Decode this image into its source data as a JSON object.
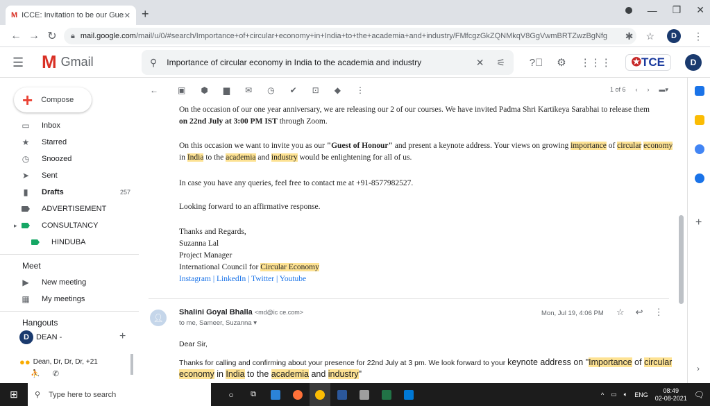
{
  "browser": {
    "tab_title": "ICCE: Invitation to be our Guest",
    "tab_close": "✕",
    "new_tab": "+",
    "url_host": "mail.google.com",
    "url_path": "/mail/u/0/#search/Importance+of+circular+economy+in+India+to+the+academia+and+industry/FMfcgzGkZQNMkqV8GgVwmBRTZwzBgNfg",
    "profile_initial": "D"
  },
  "gmail": {
    "app_name": "Gmail",
    "search_query": "Importance of circular economy in India to the academia and industry",
    "org_badge": "TCE",
    "profile_initial": "D"
  },
  "sidebar": {
    "compose": "Compose",
    "items": [
      {
        "label": "Inbox",
        "icon": "inbox-icon"
      },
      {
        "label": "Starred",
        "icon": "star-icon"
      },
      {
        "label": "Snoozed",
        "icon": "clock-icon"
      },
      {
        "label": "Sent",
        "icon": "send-icon"
      },
      {
        "label": "Drafts",
        "icon": "draft-icon",
        "count": "257"
      },
      {
        "label": "ADVERTISEMENT",
        "icon": "label-icon"
      },
      {
        "label": "CONSULTANCY",
        "icon": "label-icon"
      },
      {
        "label": "HINDUBA",
        "icon": "label-icon"
      }
    ],
    "meet_title": "Meet",
    "meet_items": [
      {
        "label": "New meeting",
        "icon": "video-icon"
      },
      {
        "label": "My meetings",
        "icon": "calendar-icon"
      }
    ],
    "hangouts_title": "Hangouts",
    "hangouts_user": "DEAN",
    "hangouts_user_suffix": "-",
    "hangouts_group": "Dean, Dr, Dr, Dr, +21"
  },
  "toolbar": {
    "pager": "1 of 6"
  },
  "email1": {
    "p1a": "On the occasion of our one year anniversary, we are releasing our 2 of our courses.  We have invited Padma Shri Kartikeya Sarabhai to release them",
    "p1b_bold": "on 22nd July at 3:00 PM IST",
    "p1b_rest": " through Zoom.",
    "p2_start": "On this occasion we want to invite you as our ",
    "p2_bold": "\"Guest of Honour\"",
    "p2_mid": " and present a keynote address. Your views on growing ",
    "p2_h1": "importance",
    "p2_of": " of ",
    "p2_h2": "circular",
    "p2_h3": "economy",
    "p2_in": " in ",
    "p2_h4": "India",
    "p2_to": " to the ",
    "p2_h5": "academia",
    "p2_and": " and ",
    "p2_h6": "industry",
    "p2_end": " would be enlightening for all of us.",
    "p3": "In case you have any queries, feel free to contact me at +91-8577982527.",
    "p4": "Looking forward to an affirmative response.",
    "sig1": "Thanks and Regards,",
    "sig2": "Suzanna Lal",
    "sig3": "Project Manager",
    "sig4_pre": "International Council for ",
    "sig4_h": "Circular Economy",
    "links": "Instagram | LinkedIn | Twitter | Youtube"
  },
  "email2": {
    "sender": "Shalini Goyal Bhalla",
    "sender_email": "<md@ic ce.com>",
    "to": "to me, Sameer, Suzanna",
    "date": "Mon, Jul 19, 4:06 PM",
    "greeting": "Dear Sir,",
    "body_start": "Thanks for calling and confirming about your presence for 22nd July at 3 pm. We look forward to your ",
    "body_big1": "keynote address on \"",
    "h1": "Importance",
    "of": " of ",
    "h2": "circular",
    "h3": "economy",
    "in": " in ",
    "h4": "India",
    "to_the": " to the ",
    "h5": "academia",
    "and": " and ",
    "h6": "industry",
    "end": "\""
  },
  "taskbar": {
    "search_placeholder": "Type here to search",
    "lang": "ENG",
    "time": "08:49",
    "date": "02-08-2021"
  }
}
